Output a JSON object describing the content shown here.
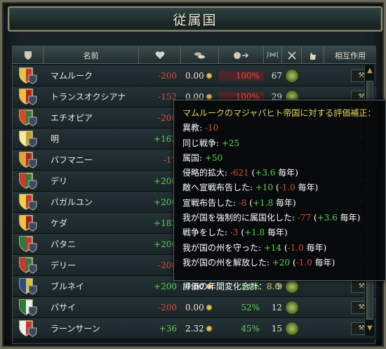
{
  "window": {
    "title": "従属国"
  },
  "columns": [
    {
      "label": "",
      "icon": "shield-icon"
    },
    {
      "label": "名前"
    },
    {
      "label": "",
      "icon": "heart-icon"
    },
    {
      "label": "",
      "icon": "coins-icon"
    },
    {
      "label": "",
      "icon": "liberty-icon"
    },
    {
      "label": "",
      "icon": "development-icon"
    },
    {
      "label": "",
      "icon": "swords-icon"
    },
    {
      "label": "",
      "icon": "hand-icon"
    },
    {
      "label": "相互作用"
    }
  ],
  "rows": [
    {
      "name": "マムルーク",
      "opinion": "-200",
      "income": "0.00",
      "liberty": "100%",
      "dev": "67"
    },
    {
      "name": "トランスオクシアナ",
      "opinion": "-152",
      "income": "0.00",
      "liberty": "100%",
      "dev": "29"
    },
    {
      "name": "エチオピア",
      "opinion": "-200",
      "income": "",
      "liberty": "",
      "dev": ""
    },
    {
      "name": "明",
      "opinion": "+162",
      "income": "",
      "liberty": "",
      "dev": ""
    },
    {
      "name": "バフマニー",
      "opinion": "-17",
      "income": "",
      "liberty": "",
      "dev": ""
    },
    {
      "name": "デリ",
      "opinion": "+200",
      "income": "",
      "liberty": "",
      "dev": ""
    },
    {
      "name": "バガルユン",
      "opinion": "+200",
      "income": "",
      "liberty": "",
      "dev": ""
    },
    {
      "name": "ケダ",
      "opinion": "+183",
      "income": "",
      "liberty": "",
      "dev": ""
    },
    {
      "name": "パタニ",
      "opinion": "+200",
      "income": "",
      "liberty": "",
      "dev": ""
    },
    {
      "name": "デリー",
      "opinion": "-200",
      "income": "",
      "liberty": "",
      "dev": ""
    },
    {
      "name": "ブルネイ",
      "opinion": "+200",
      "income": "0.00",
      "liberty": "54%",
      "dev": "9"
    },
    {
      "name": "パサイ",
      "opinion": "-200",
      "income": "0.00",
      "liberty": "52%",
      "dev": "12"
    },
    {
      "name": "ラーンサーン",
      "opinion": "+36",
      "income": "2.32",
      "liberty": "45%",
      "dev": "15"
    }
  ],
  "tooltip": {
    "title": "マムルークのマジャパヒト帝国に対する評価補正：",
    "lines": [
      {
        "label": "異教: ",
        "value": "-10",
        "value_sign": "neg",
        "rate": "",
        "suffix": ""
      },
      {
        "label": "同じ戦争: ",
        "value": "+25",
        "value_sign": "pos",
        "rate": "",
        "suffix": ""
      },
      {
        "label": "属国: ",
        "value": "+50",
        "value_sign": "pos",
        "rate": "",
        "suffix": ""
      },
      {
        "label": "侵略的拡大: ",
        "value": "-621",
        "value_sign": "neg",
        "rate": "+3.6",
        "rate_sign": "pos",
        "suffix": " 毎年)"
      },
      {
        "label": "敵へ宣戦布告した: ",
        "value": "+10",
        "value_sign": "pos",
        "rate": "-1.0",
        "rate_sign": "neg",
        "suffix": " 毎年)"
      },
      {
        "label": "宣戦布告した: ",
        "value": "-8",
        "value_sign": "neg",
        "rate": "+1.8",
        "rate_sign": "pos",
        "suffix": " 毎年)"
      },
      {
        "label": "我が国を強制的に属国化した: ",
        "value": "-77",
        "value_sign": "neg",
        "rate": "+3.6",
        "rate_sign": "pos",
        "suffix": " 毎年)"
      },
      {
        "label": "戦争をした: ",
        "value": "-3",
        "value_sign": "neg",
        "rate": "+1.8",
        "rate_sign": "pos",
        "suffix": " 毎年)"
      },
      {
        "label": "我が国の州を守った: ",
        "value": "+14",
        "value_sign": "pos",
        "rate": "-1.0",
        "rate_sign": "neg",
        "suffix": " 毎年)"
      },
      {
        "label": "我が国の州を解放した: ",
        "value": "+20",
        "value_sign": "pos",
        "rate": "-1.0",
        "rate_sign": "neg",
        "suffix": " 毎年)"
      }
    ],
    "total_label": "評価の年間変化合計：",
    "total_value": "8.0"
  }
}
